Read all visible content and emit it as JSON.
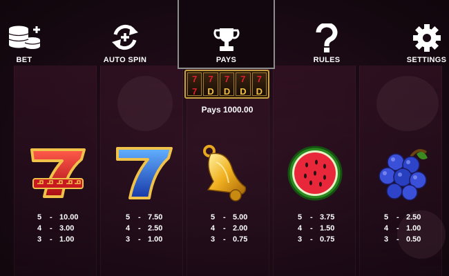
{
  "nav": {
    "items": [
      {
        "label": "BET",
        "icon": "coins-plus-icon",
        "active": false
      },
      {
        "label": "AUTO SPIN",
        "icon": "autospin-icon",
        "active": false
      },
      {
        "label": "PAYS",
        "icon": "trophy-icon",
        "active": true
      },
      {
        "label": "RULES",
        "icon": "question-icon",
        "active": false
      },
      {
        "label": "SETTINGS",
        "icon": "gear-icon",
        "active": false
      }
    ]
  },
  "pays_preview": {
    "total_label": "Pays 1000.00"
  },
  "symbols": [
    {
      "name": "red-seven",
      "pays": [
        {
          "count": "5",
          "sep": "-",
          "value": "10.00"
        },
        {
          "count": "4",
          "sep": "-",
          "value": "3.00"
        },
        {
          "count": "3",
          "sep": "-",
          "value": "1.00"
        }
      ]
    },
    {
      "name": "blue-seven",
      "pays": [
        {
          "count": "5",
          "sep": "-",
          "value": "7.50"
        },
        {
          "count": "4",
          "sep": "-",
          "value": "2.50"
        },
        {
          "count": "3",
          "sep": "-",
          "value": "1.00"
        }
      ]
    },
    {
      "name": "bell",
      "pays": [
        {
          "count": "5",
          "sep": "-",
          "value": "5.00"
        },
        {
          "count": "4",
          "sep": "-",
          "value": "2.00"
        },
        {
          "count": "3",
          "sep": "-",
          "value": "0.75"
        }
      ]
    },
    {
      "name": "watermelon",
      "pays": [
        {
          "count": "5",
          "sep": "-",
          "value": "3.75"
        },
        {
          "count": "4",
          "sep": "-",
          "value": "1.50"
        },
        {
          "count": "3",
          "sep": "-",
          "value": "0.75"
        }
      ]
    },
    {
      "name": "blueberries",
      "pays": [
        {
          "count": "5",
          "sep": "-",
          "value": "2.50"
        },
        {
          "count": "4",
          "sep": "-",
          "value": "1.00"
        },
        {
          "count": "3",
          "sep": "-",
          "value": "0.50"
        }
      ]
    }
  ],
  "colors": {
    "accent_gold": "#d9a83a",
    "active_border": "#8e8e8e",
    "red_seven": "#e0202a",
    "blue_seven": "#2a6ee0"
  }
}
